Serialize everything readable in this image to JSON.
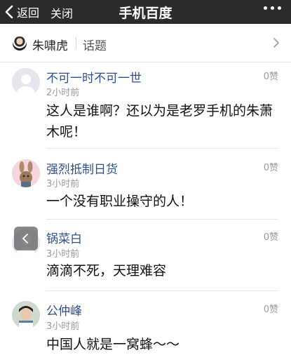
{
  "topbar": {
    "back_label": "返回",
    "close_label": "关闭",
    "title": "手机百度"
  },
  "topic": {
    "name": "朱啸虎",
    "tag": "话题"
  },
  "comments": [
    {
      "name": "不可一时不可一世",
      "time": "2小时前",
      "likes": "0赞",
      "text": "这人是谁啊？还以为是老罗手机的朱萧木呢！"
    },
    {
      "name": "强烈抵制日货",
      "time": "3小时前",
      "likes": "0赞",
      "text": "一个没有职业操守的人！"
    },
    {
      "name": "锅菜白",
      "time": "3小时前",
      "likes": "0赞",
      "text": "滴滴不死，天理难容"
    },
    {
      "name": "公仲峰",
      "time": "3小时前",
      "likes": "0赞",
      "text": "中国人就是一窝蜂～～"
    }
  ]
}
